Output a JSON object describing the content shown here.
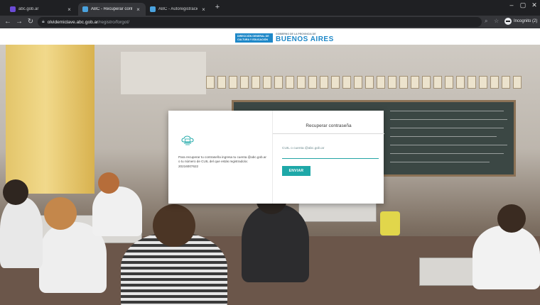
{
  "browser": {
    "tabs": [
      {
        "title": "abc.gob.ar",
        "favicon_color": "#6b4bd6",
        "active": false
      },
      {
        "title": "ABC - Recuperar contraseña",
        "favicon_color": "#4aa3df",
        "active": true
      },
      {
        "title": "ABC - Autoregistración",
        "favicon_color": "#4aa3df",
        "active": false
      }
    ],
    "tab_close": "×",
    "new_tab": "+",
    "window_controls": {
      "minimize": "–",
      "maximize": "▢",
      "close": "✕"
    },
    "address": {
      "host": "olvidemiclave.abc.gob.ar",
      "path": "/registro/forgot/"
    },
    "incognito_label": "Incognito (2)"
  },
  "site": {
    "logo_box": "DIRECCIÓN GENERAL DE CULTURA Y EDUCACIÓN",
    "logo_sub": "GOBIERNO DE LA PROVINCIA DE",
    "logo_main": "BUENOS AIRES"
  },
  "modal": {
    "title": "Recuperar contraseña",
    "info": "Para recuperar tu contraseña ingresa tu cuenta @abc.gob.ar o tu número de CUIL del que estás registrado/a: 20216007622",
    "field_label": "CUIL o cuenta @abc.gob.ar",
    "field_value": "",
    "submit_label": "ENVIAR"
  },
  "colors": {
    "accent": "#1ea8a8",
    "brand": "#1e88c8"
  }
}
